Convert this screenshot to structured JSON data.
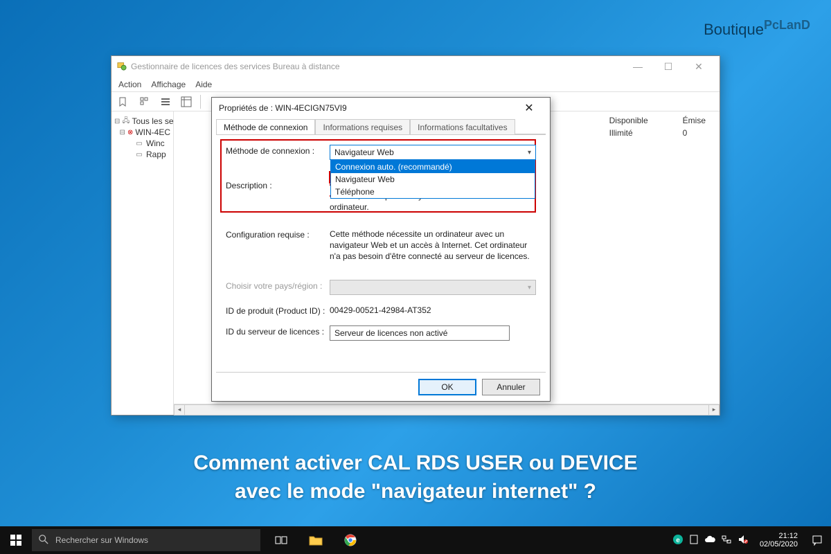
{
  "watermark": {
    "left": "Boutique",
    "right": "PcLanD"
  },
  "caption_line1": "Comment activer CAL RDS USER ou DEVICE",
  "caption_line2": "avec le mode \"navigateur internet\" ?",
  "taskbar": {
    "search_placeholder": "Rechercher sur Windows",
    "time": "21:12",
    "date": "02/05/2020"
  },
  "parent": {
    "title": "Gestionnaire de licences des services Bureau à distance",
    "menu": [
      "Action",
      "Affichage",
      "Aide"
    ],
    "tree": {
      "root": "Tous les serv",
      "server": "WIN-4EC",
      "child1": "Winc",
      "child2": "Rapp"
    },
    "cols": {
      "c1_head": "Disponible",
      "c1_val": "Illimité",
      "c2_head": "Émise",
      "c2_val": "0"
    }
  },
  "dialog": {
    "title": "Propriétés de : WIN-4ECIGN75VI9",
    "tabs": {
      "t1": "Méthode de connexion",
      "t2": "Informations requises",
      "t3": "Informations facultatives"
    },
    "labels": {
      "method": "Méthode de connexion :",
      "description": "Description :",
      "config": "Configuration requise :",
      "country": "Choisir votre pays/région :",
      "product_id": "ID de produit (Product ID) :",
      "server_id": "ID du serveur de licences :"
    },
    "combo": {
      "selected": "Navigateur Web",
      "opt1": "Connexion auto. (recommandé)",
      "opt2": "Navigateur Web",
      "opt3": "Téléphone"
    },
    "desc_strike": "Cette méthode si le serveur de licence n'a pas accès à Internet, mais que vous y avez accès via un autre",
    "desc_tail": "ordinateur.",
    "config_text": "Cette méthode nécessite un ordinateur avec un navigateur Web et un accès à Internet. Cet ordinateur n'a pas besoin d'être connecté au serveur de licences.",
    "product_id_value": "00429-00521-42984-AT352",
    "server_id_value": "Serveur de licences non activé",
    "buttons": {
      "ok": "OK",
      "cancel": "Annuler"
    }
  }
}
